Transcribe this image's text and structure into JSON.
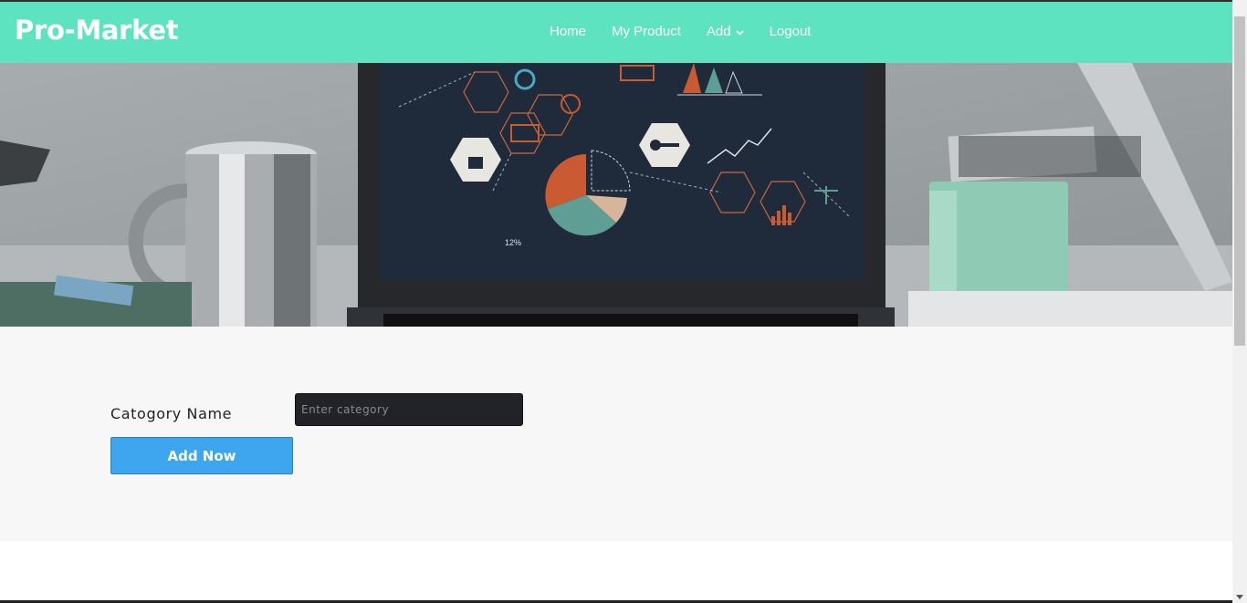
{
  "brand": "Pro-Market",
  "nav": {
    "home": "Home",
    "my_product": "My Product",
    "add": "Add",
    "logout": "Logout"
  },
  "hero": {
    "percent_label": "12%"
  },
  "form": {
    "label": "Catogory Name",
    "placeholder": "Enter category",
    "value": "",
    "button_label": "Add Now"
  },
  "colors": {
    "navbar": "#5ee3c1",
    "button": "#3ea6ee",
    "input_bg": "#222328",
    "form_bg": "#f7f7f7"
  }
}
